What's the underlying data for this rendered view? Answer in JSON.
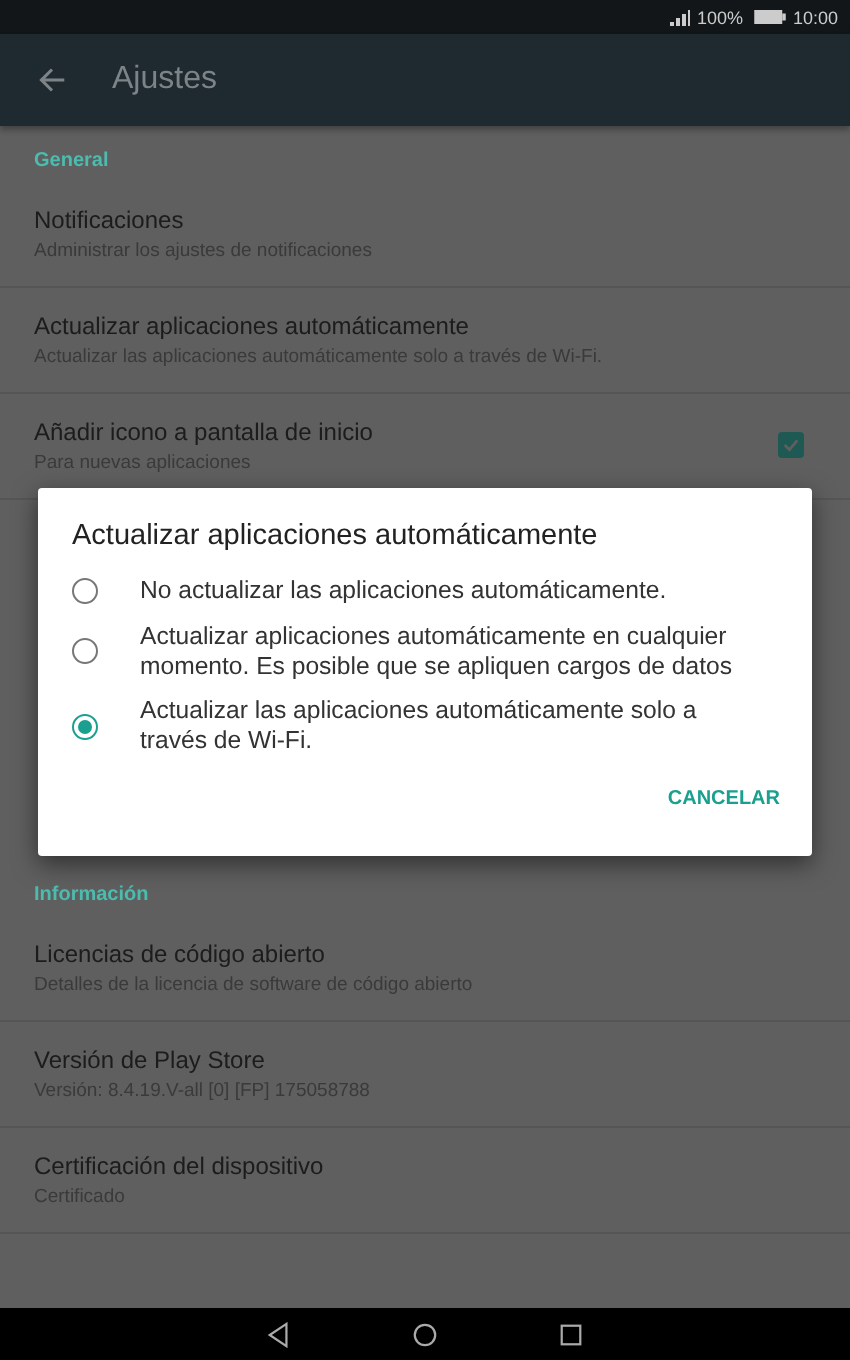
{
  "status_bar": {
    "signal": "100%",
    "time": "10:00"
  },
  "app_bar": {
    "title": "Ajustes"
  },
  "sections": [
    {
      "header": "General",
      "items": [
        {
          "title": "Notificaciones",
          "subtitle": "Administrar los ajustes de notificaciones",
          "kind": "plain"
        },
        {
          "title": "Actualizar aplicaciones automáticamente",
          "subtitle": "Actualizar las aplicaciones automáticamente solo a través de Wi-Fi.",
          "kind": "plain"
        },
        {
          "title": "Añadir icono a pantalla de inicio",
          "subtitle": "Para nuevas aplicaciones",
          "kind": "checkbox",
          "checked": true
        }
      ]
    },
    {
      "header": "Información",
      "items": [
        {
          "title": "Licencias de código abierto",
          "subtitle": "Detalles de la licencia de software de código abierto",
          "kind": "plain"
        },
        {
          "title": "Versión de Play Store",
          "subtitle": "Versión: 8.4.19.V-all [0] [FP] 175058788",
          "kind": "plain"
        },
        {
          "title": "Certificación del dispositivo",
          "subtitle": "Certificado",
          "kind": "plain"
        }
      ]
    }
  ],
  "dialog": {
    "title": "Actualizar aplicaciones automáticamente",
    "options": [
      {
        "label": "No actualizar las aplicaciones automáticamente.",
        "selected": false
      },
      {
        "label": "Actualizar aplicaciones automáticamente en cualquier momento. Es posible que se apliquen cargos de datos",
        "selected": false
      },
      {
        "label": "Actualizar las aplicaciones automáticamente solo a través de Wi-Fi.",
        "selected": true
      }
    ],
    "button": "CANCELAR"
  }
}
